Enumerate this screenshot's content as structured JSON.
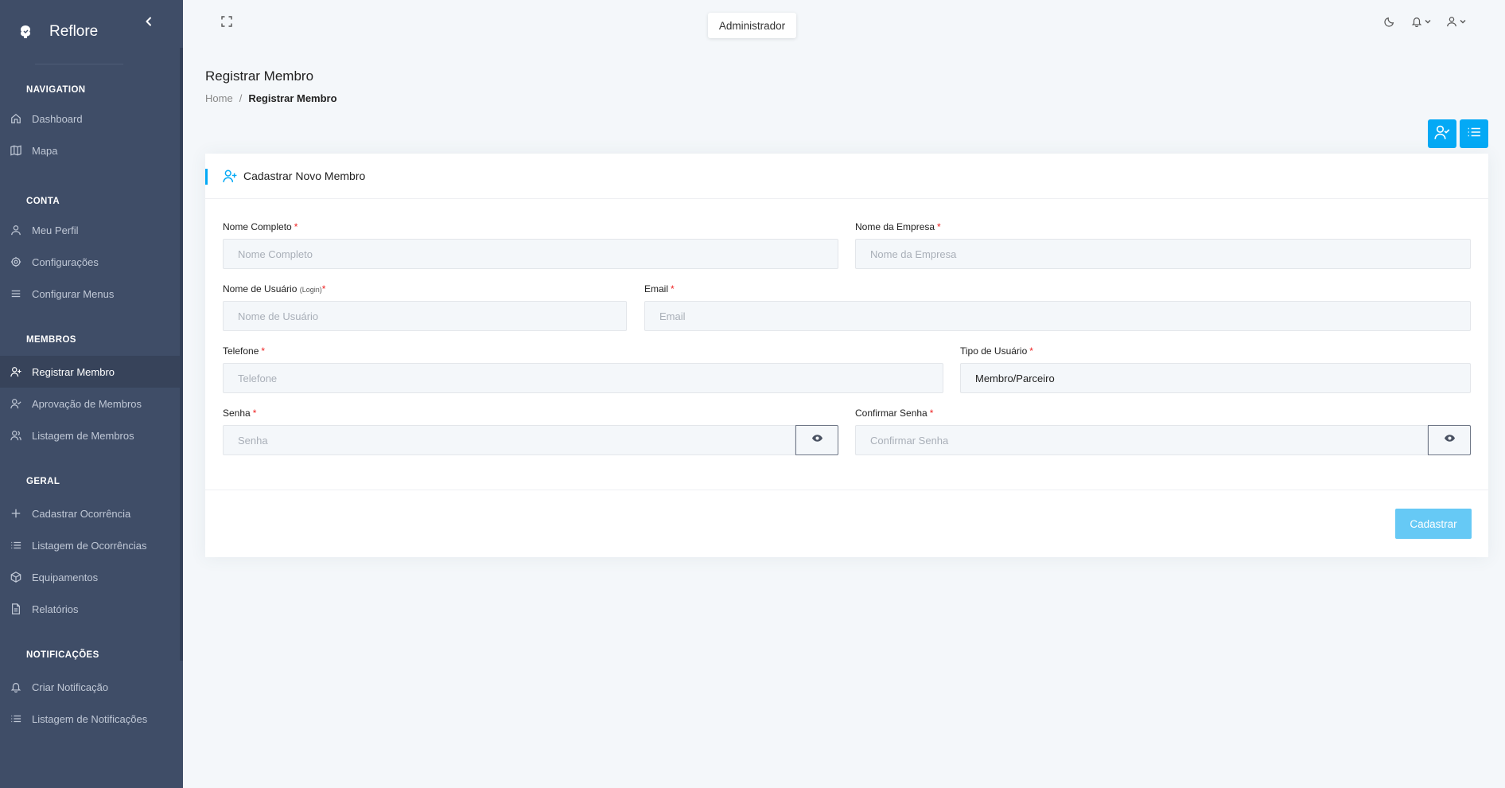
{
  "app": {
    "brand": "Reflore",
    "role": "Administrador"
  },
  "sidebar": {
    "sections": [
      {
        "title": "NAVIGATION",
        "items": [
          {
            "label": "Dashboard",
            "icon": "home-icon"
          },
          {
            "label": "Mapa",
            "icon": "map-icon"
          }
        ]
      },
      {
        "title": "CONTA",
        "items": [
          {
            "label": "Meu Perfil",
            "icon": "user-icon"
          },
          {
            "label": "Configurações",
            "icon": "settings-icon"
          },
          {
            "label": "Configurar Menus",
            "icon": "menu-icon"
          }
        ]
      },
      {
        "title": "MEMBROS",
        "items": [
          {
            "label": "Registrar Membro",
            "icon": "user-plus-icon",
            "active": true
          },
          {
            "label": "Aprovação de Membros",
            "icon": "user-check-icon"
          },
          {
            "label": "Listagem de Membros",
            "icon": "users-icon"
          }
        ]
      },
      {
        "title": "GERAL",
        "items": [
          {
            "label": "Cadastrar Ocorrência",
            "icon": "plus-icon"
          },
          {
            "label": "Listagem de Ocorrências",
            "icon": "list-icon"
          },
          {
            "label": "Equipamentos",
            "icon": "box-icon"
          },
          {
            "label": "Relatórios",
            "icon": "file-text-icon"
          }
        ]
      },
      {
        "title": "NOTIFICAÇÕES",
        "items": [
          {
            "label": "Criar Notificação",
            "icon": "bell-icon"
          },
          {
            "label": "Listagem de Notificações",
            "icon": "list-icon"
          }
        ]
      }
    ]
  },
  "page": {
    "title": "Registrar Membro",
    "breadcrumb": {
      "home": "Home",
      "separator": "/",
      "current": "Registrar Membro"
    }
  },
  "card": {
    "title": "Cadastrar Novo Membro",
    "fields": {
      "nome_completo": {
        "label": "Nome Completo",
        "placeholder": "Nome Completo",
        "required": "*"
      },
      "nome_empresa": {
        "label": "Nome da Empresa",
        "placeholder": "Nome da Empresa",
        "required": "*"
      },
      "nome_usuario": {
        "label": "Nome de Usuário",
        "label_hint": "(Login)",
        "placeholder": "Nome de Usuário",
        "required": "*"
      },
      "email": {
        "label": "Email",
        "placeholder": "Email",
        "required": "*"
      },
      "telefone": {
        "label": "Telefone",
        "placeholder": "Telefone",
        "required": "*"
      },
      "tipo_usuario": {
        "label": "Tipo de Usuário",
        "value": "Membro/Parceiro",
        "required": "*"
      },
      "senha": {
        "label": "Senha",
        "placeholder": "Senha",
        "required": "*"
      },
      "confirmar_senha": {
        "label": "Confirmar Senha",
        "placeholder": "Confirmar Senha",
        "required": "*"
      }
    },
    "submit_label": "Cadastrar"
  },
  "colors": {
    "accent": "#04a9f5",
    "sidebar_bg": "#3f4d67",
    "submit_bg": "#66c9f5",
    "required": "#ee2222"
  }
}
